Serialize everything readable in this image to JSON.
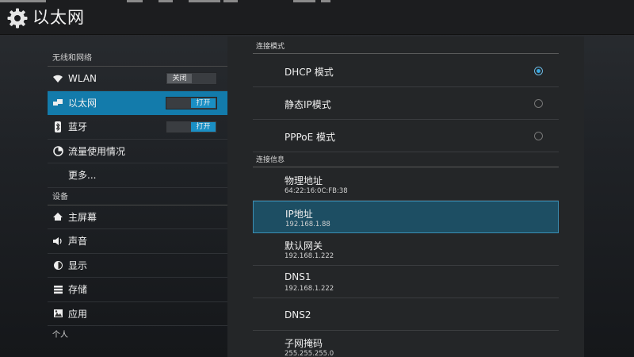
{
  "header": {
    "title": "以太网",
    "icon": "gear-icon"
  },
  "sidebar": {
    "sections": [
      {
        "heading": "无线和网络",
        "items": [
          {
            "label": "WLAN",
            "icon": "wifi-icon",
            "toggle": "关闭",
            "toggle_state": "off"
          },
          {
            "label": "以太网",
            "icon": "ethernet-icon",
            "toggle": "打开",
            "toggle_state": "on",
            "active": true
          },
          {
            "label": "蓝牙",
            "icon": "bluetooth-icon",
            "toggle": "打开",
            "toggle_state": "on"
          },
          {
            "label": "流量使用情况",
            "icon": "data-usage-icon"
          },
          {
            "label": "更多..."
          }
        ]
      },
      {
        "heading": "设备",
        "items": [
          {
            "label": "主屏幕",
            "icon": "home-icon"
          },
          {
            "label": "声音",
            "icon": "sound-icon"
          },
          {
            "label": "显示",
            "icon": "display-icon"
          },
          {
            "label": "存储",
            "icon": "storage-icon"
          },
          {
            "label": "应用",
            "icon": "apps-icon"
          }
        ]
      },
      {
        "heading": "个人",
        "items": []
      }
    ]
  },
  "panel": {
    "mode_heading": "连接模式",
    "modes": [
      {
        "label": "DHCP 模式",
        "checked": true
      },
      {
        "label": "静态IP模式",
        "checked": false
      },
      {
        "label": "PPPoE 模式",
        "checked": false
      }
    ],
    "info_heading": "连接信息",
    "info": [
      {
        "label": "物理地址",
        "value": "64:22:16:0C:FB:38"
      },
      {
        "label": "IP地址",
        "value": "192.168.1.88",
        "selected": true
      },
      {
        "label": "默认网关",
        "value": "192.168.1.222"
      },
      {
        "label": "DNS1",
        "value": "192.168.1.222"
      },
      {
        "label": "DNS2",
        "value": ""
      },
      {
        "label": "子网掩码",
        "value": "255.255.255.0"
      }
    ]
  },
  "colors": {
    "accent": "#137bab",
    "radio_checked": "#38a7e0",
    "selected_row": "#1d4e63"
  }
}
